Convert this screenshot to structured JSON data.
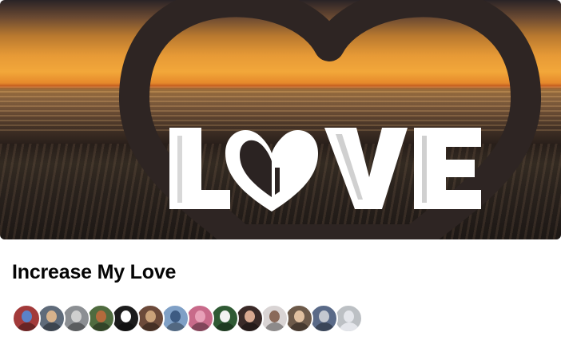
{
  "group": {
    "cover_alt": "LOVE",
    "cover_text": "LOVE",
    "name": "Increase My Love"
  },
  "members": {
    "avatars": [
      {
        "icon": "member-avatar",
        "bg": "#a23a3a",
        "accent": "#5a82c8"
      },
      {
        "icon": "member-avatar",
        "bg": "#5f6b7a",
        "accent": "#d7b28c"
      },
      {
        "icon": "member-avatar",
        "bg": "#8c8f93",
        "accent": "#cfcfcf"
      },
      {
        "icon": "member-avatar",
        "bg": "#4f6b3f",
        "accent": "#b36a3c"
      },
      {
        "icon": "member-avatar",
        "bg": "#1c1c1c",
        "accent": "#ffffff"
      },
      {
        "icon": "member-avatar",
        "bg": "#6c4a3a",
        "accent": "#caa27a"
      },
      {
        "icon": "member-avatar",
        "bg": "#7fa0c6",
        "accent": "#3d5b82"
      },
      {
        "icon": "member-avatar",
        "bg": "#c86a8a",
        "accent": "#e8a0b8"
      },
      {
        "icon": "member-avatar",
        "bg": "#2f5a34",
        "accent": "#f2f2f2"
      },
      {
        "icon": "member-avatar",
        "bg": "#3a2a28",
        "accent": "#d8a890"
      },
      {
        "icon": "member-avatar",
        "bg": "#d9d4d4",
        "accent": "#8a6a5a"
      },
      {
        "icon": "member-avatar",
        "bg": "#6d5a4a",
        "accent": "#e0c0a0"
      },
      {
        "icon": "member-avatar",
        "bg": "#5a6a88",
        "accent": "#c4c8d0"
      },
      {
        "icon": "default-avatar",
        "bg": "#bcc0c4",
        "accent": "#e4e6eb"
      }
    ]
  }
}
